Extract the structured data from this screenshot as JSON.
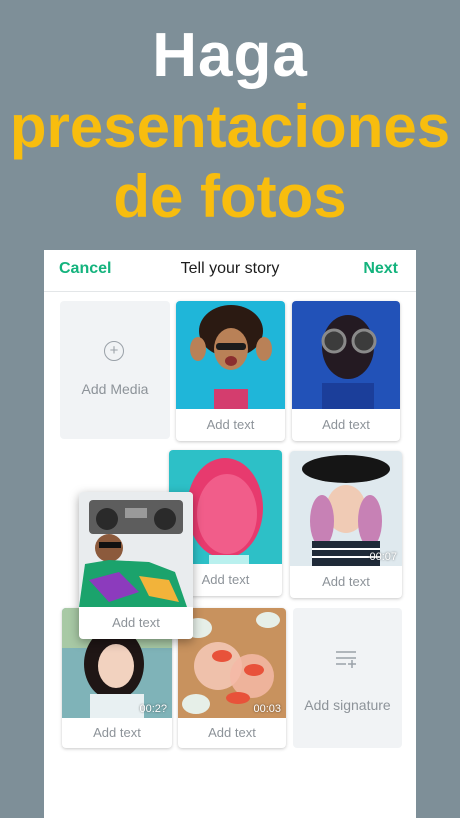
{
  "headline": {
    "line1": "Haga",
    "line2": "presentaciones",
    "line3": "de fotos"
  },
  "nav": {
    "cancel": "Cancel",
    "title": "Tell your story",
    "next": "Next"
  },
  "add_media_label": "Add Media",
  "add_signature_label": "Add signature",
  "cards": [
    {
      "caption": "Add text"
    },
    {
      "caption": "Add text"
    },
    {
      "caption": "Add text"
    },
    {
      "caption": "Add text",
      "duration": "00:07"
    },
    {
      "caption": "Add text"
    },
    {
      "caption": "Add text",
      "duration": "00:2?"
    },
    {
      "caption": "Add text",
      "duration": "00:03"
    }
  ],
  "colors": {
    "background": "#7e8f98",
    "accent_yellow": "#f8bd0e",
    "accent_green": "#14b37d"
  }
}
